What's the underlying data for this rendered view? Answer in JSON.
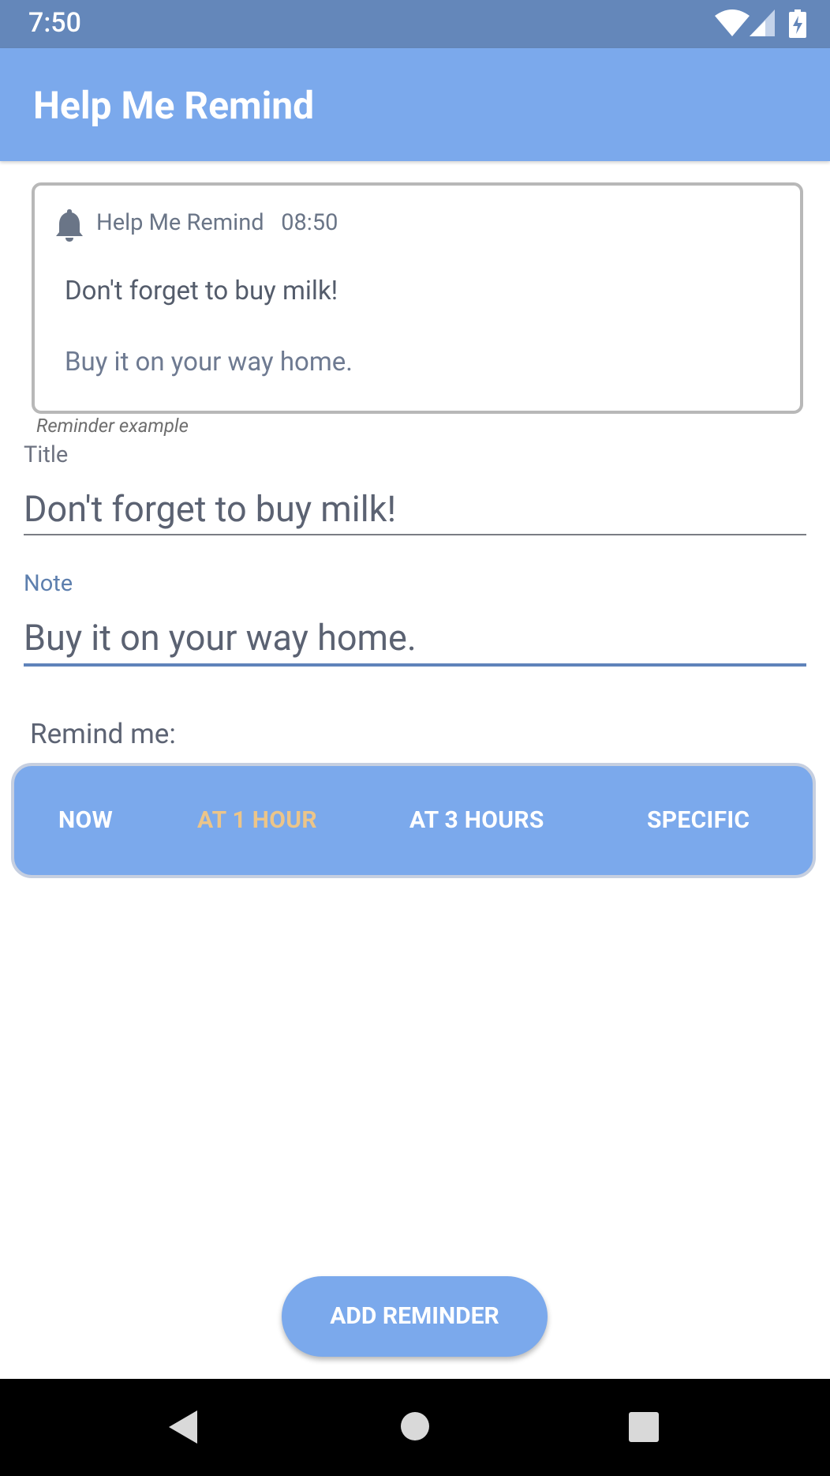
{
  "status_bar": {
    "time": "7:50",
    "icons": [
      "wifi-icon",
      "cell-signal-icon",
      "battery-charging-icon"
    ],
    "background": "#6487ba"
  },
  "app_bar": {
    "title": "Help Me Remind",
    "background": "#7ba9ec"
  },
  "preview": {
    "icon": "bell-icon",
    "app_name": "Help Me Remind",
    "time": "08:50",
    "title": "Don't forget to buy milk!",
    "note": "Buy it on your way home.",
    "caption": "Reminder example"
  },
  "form": {
    "title_label": "Title",
    "title_value": "Don't forget to buy milk!",
    "note_label": "Note",
    "note_value": "Buy it on your way home.",
    "remind_label": "Remind me:"
  },
  "remind_options": {
    "items": [
      "NOW",
      "AT 1 HOUR",
      "AT 3 HOURS",
      "SPECIFIC"
    ],
    "selected": "AT 1 HOUR",
    "selected_color": "#ecc589"
  },
  "actions": {
    "add_label": "ADD REMINDER"
  },
  "nav_bar": {
    "icons": [
      "back-icon",
      "home-icon",
      "recents-icon"
    ]
  }
}
